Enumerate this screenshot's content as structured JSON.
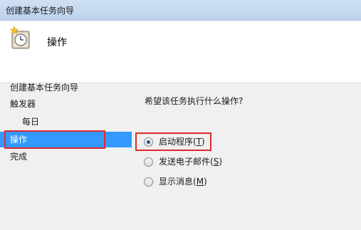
{
  "window": {
    "title": "创建基本任务向导"
  },
  "header": {
    "title": "操作",
    "icon": "clock-icon"
  },
  "sidebar": {
    "items": [
      {
        "label": "创建基本任务向导"
      },
      {
        "label": "触发器"
      },
      {
        "label": "每日"
      },
      {
        "label": "操作"
      },
      {
        "label": "完成"
      }
    ],
    "selected": "操作"
  },
  "main": {
    "question": "希望该任务执行什么操作?",
    "options": [
      {
        "label": "启动程序(",
        "mnemonic": "T",
        "suffix": ")",
        "checked": true
      },
      {
        "label": "发送电子邮件(",
        "mnemonic": "S",
        "suffix": ")",
        "checked": false
      },
      {
        "label": "显示消息(",
        "mnemonic": "M",
        "suffix": ")",
        "checked": false
      }
    ]
  },
  "colors": {
    "selection": "#3399ff",
    "highlight_box": "#e0282d"
  }
}
